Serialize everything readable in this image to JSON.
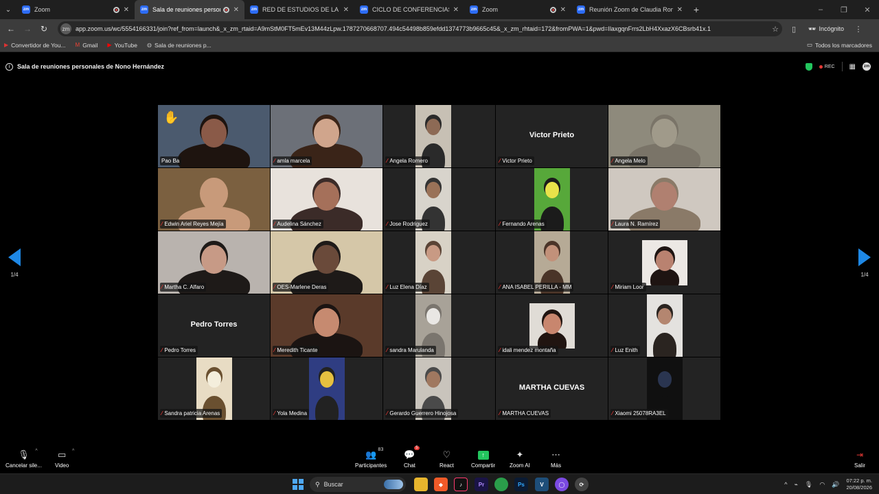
{
  "browser": {
    "tabs": [
      {
        "label": "Zoom",
        "active": false,
        "recording": true
      },
      {
        "label": "Sala de reuniones personal",
        "active": true,
        "recording": true
      },
      {
        "label": "RED DE ESTUDIOS DE LA VIOL",
        "active": false,
        "recording": false
      },
      {
        "label": "CICLO DE CONFERENCIAS IEE",
        "active": false,
        "recording": false
      },
      {
        "label": "Zoom",
        "active": false,
        "recording": true
      },
      {
        "label": "Reunión Zoom de Claudia Rom",
        "active": false,
        "recording": false
      }
    ],
    "url": "app.zoom.us/wc/5554166331/join?ref_from=launch&_x_zm_rtaid=A9mStM0FT5mEv13M44zLpw.1787270668707.494c54498b859efdd1374773b9665c45&_x_zm_rhtaid=172&fromPWA=1&pwd=IlaxgqnFrrs2LbH4XxazX6CBsrb41x.1",
    "incognito_label": "Incógnito",
    "bookmarks": [
      {
        "label": "Convertidor de You...",
        "icon": "convert-icon"
      },
      {
        "label": "Gmail",
        "icon": "gmail-icon"
      },
      {
        "label": "YouTube",
        "icon": "youtube-icon"
      },
      {
        "label": "Sala de reuniones p...",
        "icon": "globe-icon"
      }
    ],
    "all_bookmarks_label": "Todos los marcadores"
  },
  "meeting": {
    "title": "Sala de reuniones personales de Nono Hernández",
    "rec_label": "REC",
    "page_indicator": "1/4",
    "participants": [
      {
        "name": "Pao Ba",
        "type": "video",
        "highlight": true,
        "hand": true,
        "muted": false,
        "bg": "#4b5a6e",
        "face": "#8a5a48",
        "hair": "#1e140f"
      },
      {
        "name": "amla marcela",
        "type": "video",
        "muted": true,
        "bg": "#6c7078",
        "face": "#d0a58c",
        "hair": "#3a2418"
      },
      {
        "name": "Angela Romero",
        "type": "narrow",
        "muted": true,
        "bg": "#c7c0b4",
        "face": "#8d6a55",
        "hair": "#2a2a2a"
      },
      {
        "name": "Victor Prieto",
        "type": "name",
        "muted": true
      },
      {
        "name": "Angela Melo",
        "type": "video",
        "muted": true,
        "bg": "#8e8a7c",
        "face": "#a09a8a",
        "hair": "#7a7468"
      },
      {
        "name": "Edwin Ariel Reyes Mejía",
        "type": "video",
        "muted": true,
        "bg": "#7b6040",
        "face": "#c89a7a",
        "hair": "#c89a7a"
      },
      {
        "name": "Audelina Sánchez",
        "type": "video",
        "muted": true,
        "bg": "#e8e2dc",
        "face": "#a5705a",
        "hair": "#3b2b28"
      },
      {
        "name": "Jose Rodriguez",
        "type": "narrow",
        "muted": true,
        "bg": "#d8d4cc",
        "face": "#9a7258",
        "hair": "#333333"
      },
      {
        "name": "Fernando Arenas",
        "type": "narrow",
        "muted": true,
        "bg": "#57a83a",
        "face": "#e9e24a",
        "hair": "#1b1b1b"
      },
      {
        "name": "Laura N. Ramírez",
        "type": "video",
        "muted": true,
        "bg": "#cfc8c0",
        "face": "#b08070",
        "hair": "#8a7a68"
      },
      {
        "name": "Martha C. Alfaro",
        "type": "video",
        "muted": true,
        "bg": "#b9b3ae",
        "face": "#c79a86",
        "hair": "#1e1a18"
      },
      {
        "name": "OES-Marlene Deras",
        "type": "video",
        "muted": true,
        "bg": "#d5c7a8",
        "face": "#6a4a3a",
        "hair": "#1e1a18"
      },
      {
        "name": "Luz Elena Díaz",
        "type": "narrow",
        "muted": true,
        "bg": "#d8d2c6",
        "face": "#c89a84",
        "hair": "#5a4436"
      },
      {
        "name": "ANA ISABEL PERILLA - MM",
        "type": "narrow",
        "muted": true,
        "bg": "#b6aa96",
        "face": "#c2917a",
        "hair": "#4a3428"
      },
      {
        "name": "Miriam Loor",
        "type": "small",
        "muted": true,
        "bg": "#ece8e4",
        "face": "#b98270",
        "hair": "#1e1412"
      },
      {
        "name": "Pedro Torres",
        "type": "name",
        "muted": true
      },
      {
        "name": "Meredith Ticante",
        "type": "video",
        "muted": true,
        "bg": "#5a3a2a",
        "face": "#c68a70",
        "hair": "#1b1412"
      },
      {
        "name": "sandra Marulanda",
        "type": "narrow",
        "muted": true,
        "bg": "#a8a298",
        "face": "#e9e7e4",
        "hair": "#7a756e"
      },
      {
        "name": "idali mendez montaña",
        "type": "small",
        "muted": true,
        "bg": "#e0dcd6",
        "face": "#c8866e",
        "hair": "#201410"
      },
      {
        "name": "Luz Enith",
        "type": "narrow",
        "muted": true,
        "bg": "#e4e2df",
        "face": "#b48670",
        "hair": "#2a2420"
      },
      {
        "name": "Sandra patricia Arenas",
        "type": "narrow",
        "muted": true,
        "bg": "#e8dcc4",
        "face": "#f4eedc",
        "hair": "#6a5030"
      },
      {
        "name": "Yola Medina",
        "type": "narrow",
        "muted": true,
        "bg": "#2f3d82",
        "face": "#e6c040",
        "hair": "#222222"
      },
      {
        "name": "Gerardo Guerrero Hinojosa",
        "type": "narrow",
        "muted": true,
        "bg": "#c9c4bc",
        "face": "#a07860",
        "hair": "#4a4a4a"
      },
      {
        "name": "MARTHA CUEVAS",
        "type": "name",
        "muted": true
      },
      {
        "name": "Xiaomi 25078RA3EL",
        "type": "dark",
        "muted": true,
        "bg": "#101010",
        "face": "#2a3550",
        "hair": "#101010"
      }
    ]
  },
  "controls": {
    "mute_label": "Cancelar sile...",
    "video_label": "Video",
    "participants_label": "Participantes",
    "participants_count": "83",
    "chat_label": "Chat",
    "chat_badge": "5",
    "react_label": "React",
    "share_label": "Compartir",
    "zoom_ai_label": "Zoom AI",
    "more_label": "Más",
    "leave_label": "Salir"
  },
  "taskbar": {
    "search_placeholder": "Buscar",
    "time": "07:22 p. m.",
    "date": "20/08/2026"
  },
  "colors": {
    "highlight_green": "#23c55e",
    "mute_red": "#e53935",
    "pager_blue": "#1e88e5",
    "tile_bg": "#232323"
  }
}
